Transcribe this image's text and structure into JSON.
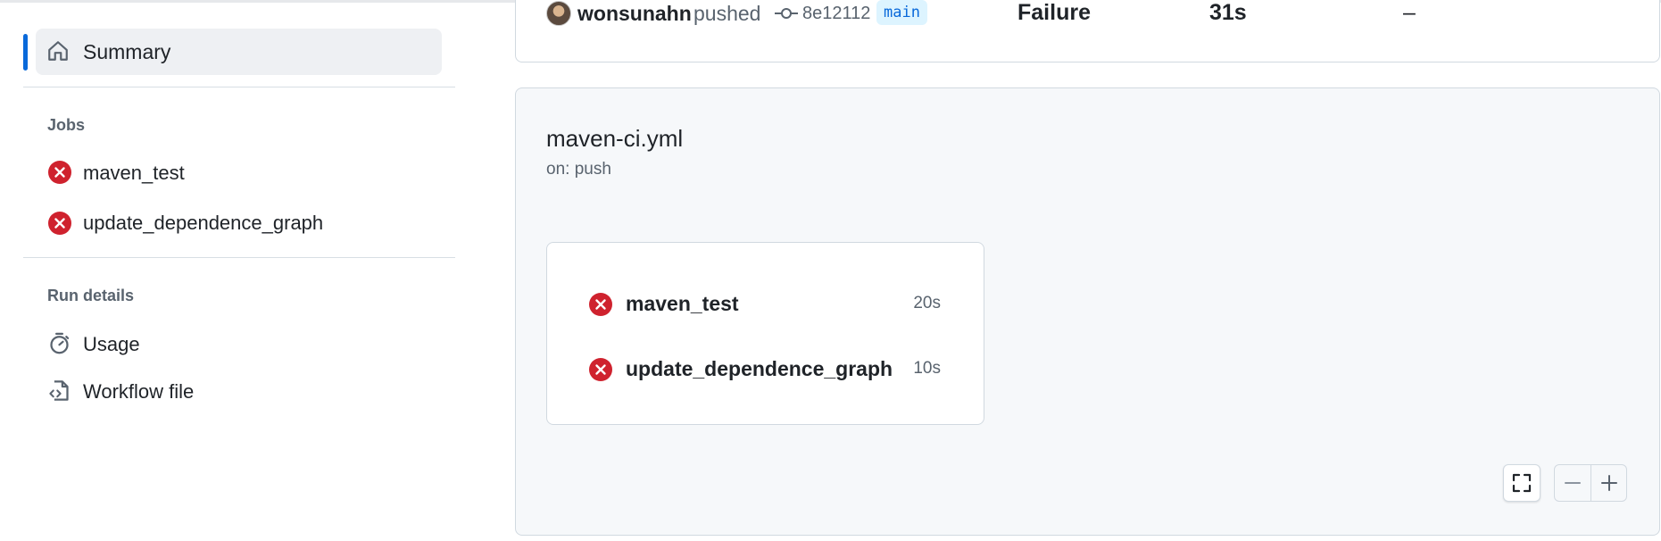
{
  "sidebar": {
    "summary_label": "Summary",
    "jobs_heading": "Jobs",
    "jobs": [
      {
        "label": "maven_test",
        "status": "failure"
      },
      {
        "label": "update_dependence_graph",
        "status": "failure"
      }
    ],
    "run_details_heading": "Run details",
    "run_details": [
      {
        "label": "Usage",
        "icon": "stopwatch-icon"
      },
      {
        "label": "Workflow file",
        "icon": "file-code-icon"
      }
    ]
  },
  "run": {
    "actor": "wonsunahn",
    "action": "pushed",
    "commit_sha": "8e12112",
    "branch": "main",
    "status": "Failure",
    "duration": "31s",
    "artifacts": "–"
  },
  "workflow": {
    "name": "maven-ci.yml",
    "trigger": "on: push",
    "jobs": [
      {
        "name": "maven_test",
        "duration": "20s",
        "status": "failure"
      },
      {
        "name": "update_dependence_graph",
        "duration": "10s",
        "status": "failure"
      }
    ]
  },
  "colors": {
    "accent": "#0969da",
    "failure": "#cf222e",
    "muted_text": "#59636e",
    "branch_bg": "#ddf4ff"
  }
}
